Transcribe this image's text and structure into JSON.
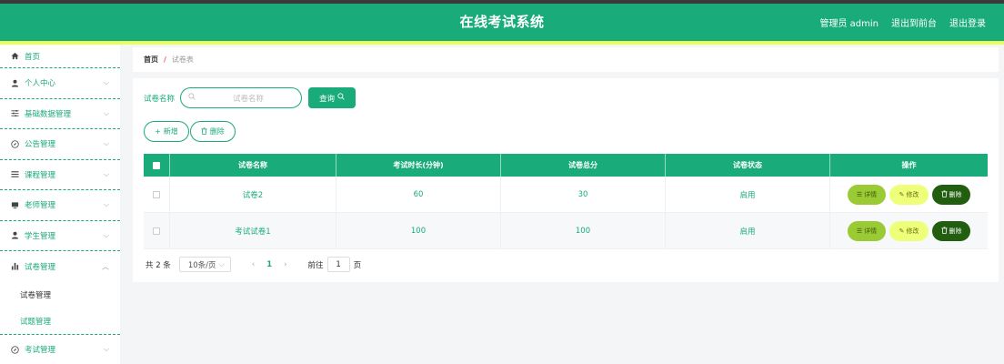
{
  "header": {
    "title": "在线考试系统",
    "admin_label": "管理员 admin",
    "back_label": "退出到前台",
    "logout_label": "退出登录"
  },
  "sidebar": {
    "home": "首页",
    "items": [
      {
        "label": "个人中心",
        "icon": "person-icon"
      },
      {
        "label": "基础数据管理",
        "icon": "sliders-icon"
      },
      {
        "label": "公告管理",
        "icon": "compass-icon"
      },
      {
        "label": "课程管理",
        "icon": "list-icon"
      },
      {
        "label": "老师管理",
        "icon": "monitor-icon"
      },
      {
        "label": "学生管理",
        "icon": "person-icon"
      },
      {
        "label": "试卷管理",
        "icon": "bar-chart-icon"
      }
    ],
    "subitems": [
      "试卷管理",
      "试题管理"
    ],
    "last_item": "考试管理"
  },
  "breadcrumb": {
    "home": "首页",
    "separator": "/",
    "current": "试卷表"
  },
  "search": {
    "label": "试卷名称",
    "placeholder": "试卷名称",
    "button": "查询"
  },
  "actions": {
    "add": "新增",
    "delete": "删除"
  },
  "table": {
    "columns": [
      "试卷名称",
      "考试时长(分钟)",
      "试卷总分",
      "试卷状态",
      "操作"
    ],
    "rows": [
      {
        "name": "试卷2",
        "duration": "60",
        "score": "30",
        "status": "启用"
      },
      {
        "name": "考试试卷1",
        "duration": "100",
        "score": "100",
        "status": "启用"
      }
    ],
    "ops": {
      "detail": "详情",
      "edit": "修改",
      "delete": "删除"
    }
  },
  "pager": {
    "total": "共 2 条",
    "page_size": "10条/页",
    "current_page": "1",
    "goto_prefix": "前往",
    "goto_value": "1",
    "goto_suffix": "页"
  },
  "colors": {
    "accent": "#1aab7a",
    "highlight": "#e8ff5e",
    "detail": "#9acb34",
    "edit": "#eeff7a",
    "delete": "#225e0f"
  }
}
